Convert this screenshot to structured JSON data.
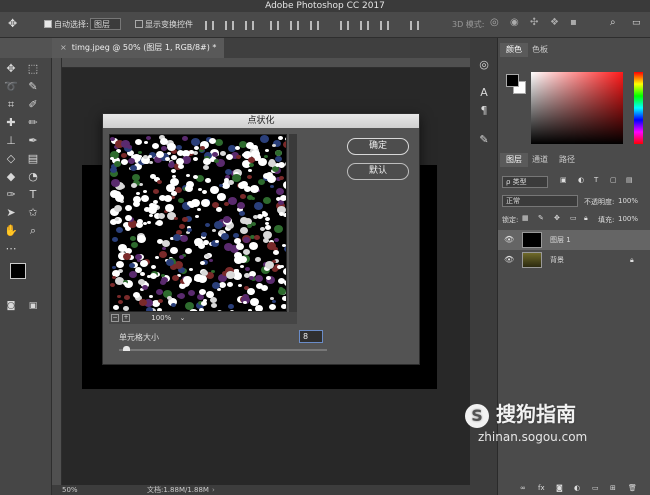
{
  "app_title": "Adobe Photoshop CC 2017",
  "options_bar": {
    "auto_select_label": "自动选择:",
    "auto_select_value": "图层",
    "show_transform_label": "显示变换控件",
    "mode_3d_label": "3D 模式:"
  },
  "document_tab": {
    "title": "timg.jpeg @ 50% (图层 1, RGB/8#) *"
  },
  "status_bar": {
    "zoom": "50%",
    "doc_info": "文档:1.88M/1.88M"
  },
  "dialog": {
    "title": "点状化",
    "ok_label": "确定",
    "default_label": "默认",
    "zoom_level": "100%",
    "cell_size_label": "单元格大小",
    "cell_size_value": "8",
    "cell_size_fraction": 0.02
  },
  "color_panel": {
    "tabs": [
      "颜色",
      "色板"
    ],
    "foreground": "#000000",
    "background": "#ffffff"
  },
  "layers_panel": {
    "tabs": [
      "图层",
      "通道",
      "路径"
    ],
    "filter_label": "ρ 类型",
    "blend_mode": "正常",
    "opacity_label": "不透明度:",
    "opacity_value": "100%",
    "lock_label": "锁定:",
    "fill_label": "填充:",
    "fill_value": "100%",
    "layers": [
      {
        "name": "图层 1",
        "selected": true
      },
      {
        "name": "背景",
        "selected": false
      }
    ]
  },
  "watermark": {
    "brand": "搜狗指南",
    "url": "zhinan.sogou.com"
  }
}
